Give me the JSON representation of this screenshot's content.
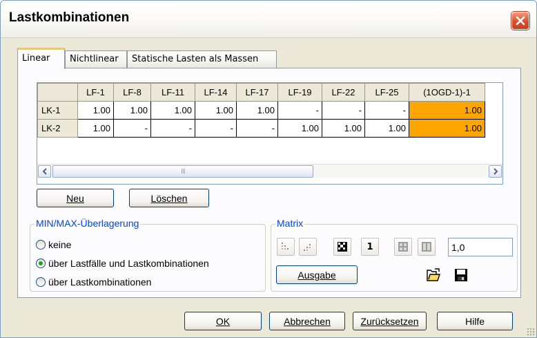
{
  "window": {
    "title": "Lastkombinationen"
  },
  "tabs": [
    {
      "label": "Linear"
    },
    {
      "label": "Nichtlinear"
    },
    {
      "label": "Statische Lasten als Massen"
    }
  ],
  "grid": {
    "columns": [
      "",
      "LF-1",
      "LF-8",
      "LF-11",
      "LF-14",
      "LF-17",
      "LF-19",
      "LF-22",
      "LF-25",
      "(1OGD-1)-1"
    ],
    "rows": [
      {
        "label": "LK-1",
        "cells": [
          "1.00",
          "1.00",
          "1.00",
          "1.00",
          "1.00",
          "-",
          "-",
          "-",
          "1.00"
        ]
      },
      {
        "label": "LK-2",
        "cells": [
          "1.00",
          "-",
          "-",
          "-",
          "-",
          "1.00",
          "1.00",
          "1.00",
          "1.00"
        ]
      }
    ],
    "highlight_color": "#ffa500"
  },
  "scrollbar": {
    "thumb_grip": "III"
  },
  "buttons": {
    "neu": "Neu",
    "loeschen": "Löschen"
  },
  "minmax": {
    "title": "MIN/MAX-Überlagerung",
    "options": [
      "keine",
      "über Lastfälle und Lastkombinationen",
      "über Lastkombinationen"
    ],
    "selected": 1
  },
  "matrix": {
    "title": "Matrix",
    "one_label": "1",
    "value": "1,0",
    "ausgabe": "Ausgabe"
  },
  "footer": {
    "ok": "OK",
    "abbrechen": "Abbrechen",
    "zuruecksetzen": "Zurücksetzen",
    "hilfe": "Hilfe"
  }
}
